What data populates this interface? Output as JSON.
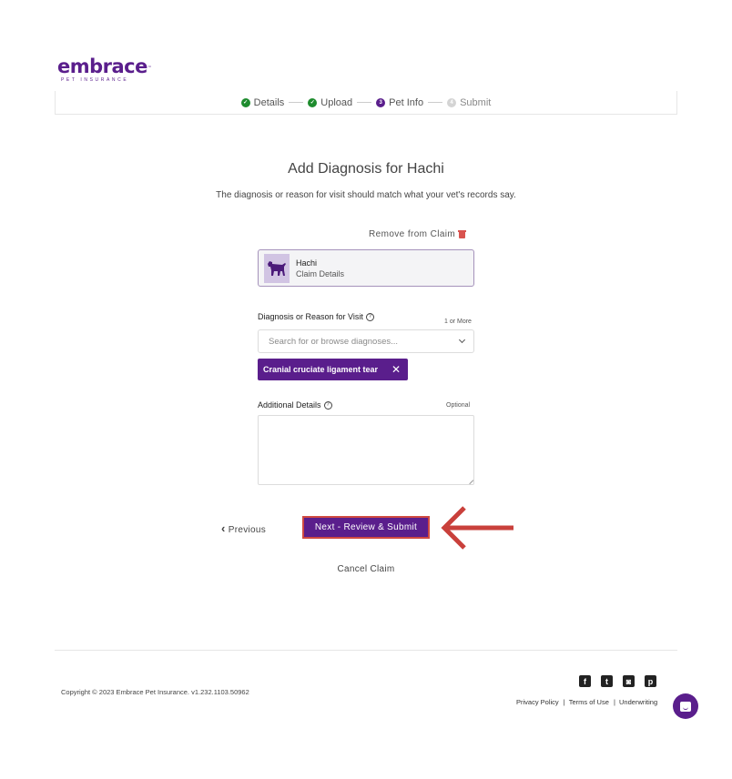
{
  "brand": {
    "name": "embrace",
    "trademark": "™",
    "tagline": "PET INSURANCE",
    "color": "#5a1e8c"
  },
  "stepper": {
    "steps": [
      {
        "label": "Details",
        "state": "done",
        "marker": "✓"
      },
      {
        "label": "Upload",
        "state": "done",
        "marker": "✓"
      },
      {
        "label": "Pet Info",
        "state": "current",
        "marker": "3"
      },
      {
        "label": "Submit",
        "state": "todo",
        "marker": "4"
      }
    ]
  },
  "page": {
    "title": "Add Diagnosis for Hachi",
    "subtitle": "The diagnosis or reason for visit should match what your vet's records say."
  },
  "pet": {
    "remove_label": "Remove from Claim",
    "name": "Hachi",
    "sub": "Claim Details"
  },
  "diagnosis": {
    "label": "Diagnosis or Reason for Visit",
    "help": "?",
    "hint": "1 or More",
    "placeholder": "Search for or browse diagnoses...",
    "selected": [
      {
        "label": "Cranial cruciate ligament tear",
        "remove": "✕"
      }
    ]
  },
  "details": {
    "label": "Additional Details",
    "help": "?",
    "hint": "Optional",
    "value": ""
  },
  "actions": {
    "previous": "Previous",
    "previous_icon": "‹",
    "next": "Next - Review & Submit",
    "cancel": "Cancel Claim"
  },
  "footer": {
    "copyright": "Copyright © 2023   Embrace Pet Insurance. v1.232.1103.50962",
    "socials": [
      {
        "name": "facebook",
        "glyph": "f"
      },
      {
        "name": "twitter",
        "glyph": "t"
      },
      {
        "name": "instagram",
        "glyph": "◙"
      },
      {
        "name": "pinterest",
        "glyph": "p"
      }
    ],
    "links": [
      "Privacy Policy",
      "Terms of Use",
      "Underwriting"
    ],
    "separator": "|"
  }
}
